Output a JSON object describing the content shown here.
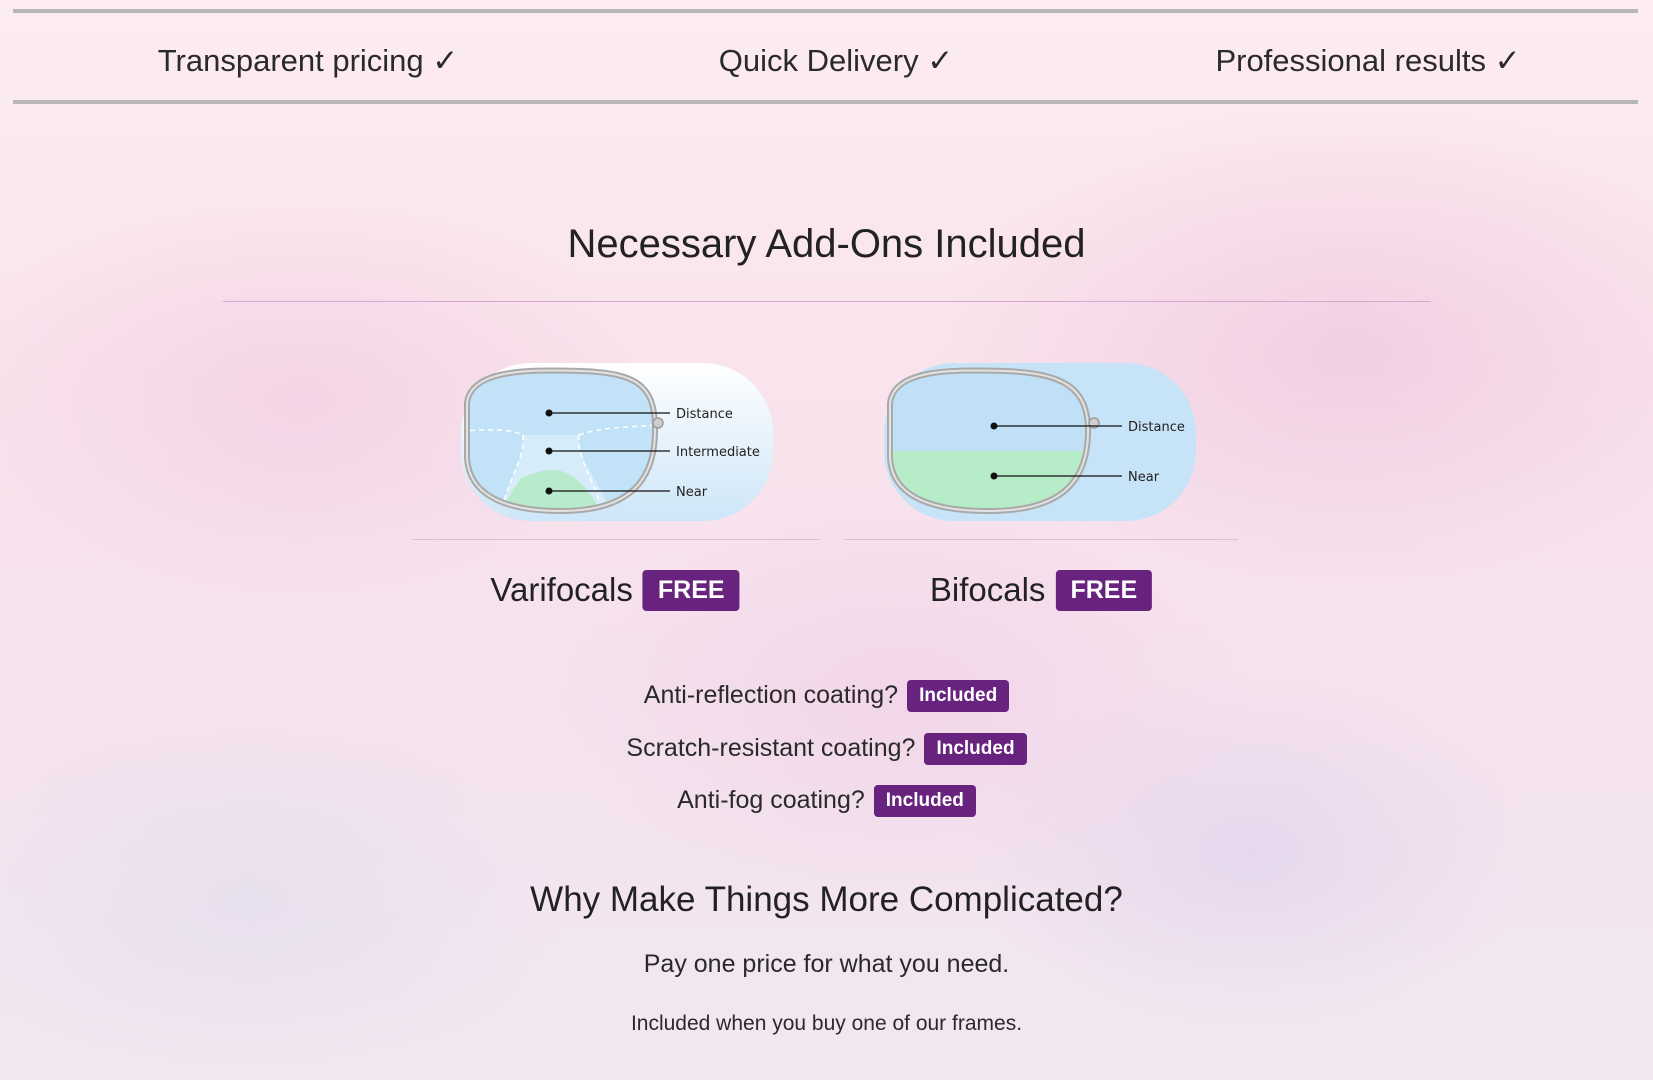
{
  "features": [
    {
      "label": "Transparent pricing ✓"
    },
    {
      "label": "Quick Delivery ✓"
    },
    {
      "label": "Professional results ✓"
    }
  ],
  "addons": {
    "title": "Necessary Add-Ons Included",
    "lenses": [
      {
        "name": "Varifocals",
        "badge": "FREE",
        "zones": [
          "Distance",
          "Intermediate",
          "Near"
        ]
      },
      {
        "name": "Bifocals",
        "badge": "FREE",
        "zones": [
          "Distance",
          "Near"
        ]
      }
    ],
    "coatings": [
      {
        "label": "Anti-reflection coating?",
        "badge": "Included"
      },
      {
        "label": "Scratch-resistant coating?",
        "badge": "Included"
      },
      {
        "label": "Anti-fog coating?",
        "badge": "Included"
      }
    ]
  },
  "why": {
    "title": "Why Make Things More Complicated?",
    "line1": "Pay one price for what you need.",
    "line2": "Included when you buy one of our frames."
  },
  "colors": {
    "badge": "#68237e",
    "rule": "#d9a6d4",
    "border": "#b9b6b9"
  }
}
